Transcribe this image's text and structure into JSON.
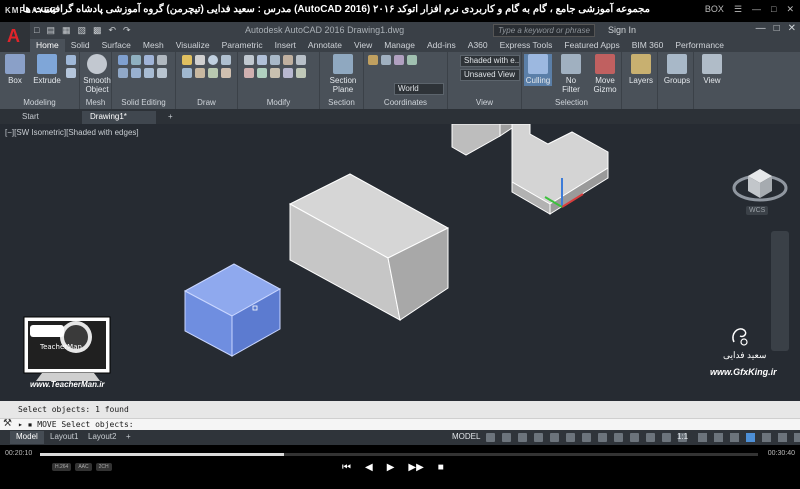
{
  "player": {
    "brand": "KMPLAYER",
    "video_title": "مجموعه آموزشی جامع ، گام به گام و کاربردی نرم افزار اتوکد ۲۰۱۶ (AutoCAD 2016) مدرس : سعید فدایی (تیچرمن) گروه آموزشی پادشاه گرافیست ها",
    "top_controls": [
      "BOX",
      "☰",
      "—",
      "□",
      "✕"
    ],
    "time_elapsed": "00:20:10",
    "time_total": "00:30:40",
    "progress_fraction": 0.34,
    "badges": [
      "H.264",
      "AAC",
      "2CH"
    ],
    "controls": [
      "⏮",
      "◀",
      "▶",
      "▶▶",
      "■"
    ]
  },
  "acad": {
    "app_letter": "A",
    "document_title": "Autodesk AutoCAD 2016    Drawing1.dwg",
    "search_placeholder": "Type a keyword or phrase",
    "sign_in": "Sign In",
    "window_buttons": [
      "—",
      "□",
      "✕"
    ]
  },
  "ribbon_tabs": [
    "Home",
    "Solid",
    "Surface",
    "Mesh",
    "Visualize",
    "Parametric",
    "Insert",
    "Annotate",
    "View",
    "Manage",
    "Add-ins",
    "A360",
    "Express Tools",
    "Featured Apps",
    "BIM 360",
    "Performance"
  ],
  "ribbon": {
    "box": "Box",
    "extrude": "Extrude",
    "smooth_object": "Smooth Object",
    "section_plane": "Section Plane",
    "visual_style": "Shaded with e...",
    "saved_view": "Unsaved View",
    "ucs": "World",
    "culling": "Culling",
    "no_filter": "No Filter",
    "move_gizmo": "Move Gizmo",
    "layers": "Layers",
    "groups": "Groups",
    "view": "View",
    "panels": [
      "Modeling",
      "Mesh",
      "Solid Editing",
      "Draw",
      "Modify",
      "Section",
      "Coordinates",
      "View",
      "Selection"
    ]
  },
  "doc_tabs": [
    "Start",
    "Drawing1*",
    "+"
  ],
  "viewport": {
    "label": "[−][SW Isometric][Shaded with edges]",
    "wcs": "WCS"
  },
  "watermark": {
    "teacherman_url": "www.TeacherMan.ir",
    "teacherman_logo_text": "TeacherMan",
    "gfx_name": "سعید فدایی",
    "gfx_url": "www.GfxKing.ir"
  },
  "command": {
    "history": "Select objects: 1 found",
    "prompt": "▸ ▪ MOVE Select objects:"
  },
  "status": {
    "layout_tabs": [
      "Model",
      "Layout1",
      "Layout2",
      "+"
    ],
    "model": "MODEL",
    "scale": "1:1"
  },
  "colors": {
    "selected_box": "#6f8ee0",
    "grey_solid": "#c9c9c9",
    "viewport_bg": "#262b32",
    "ribbon_bg": "#4a5159"
  }
}
